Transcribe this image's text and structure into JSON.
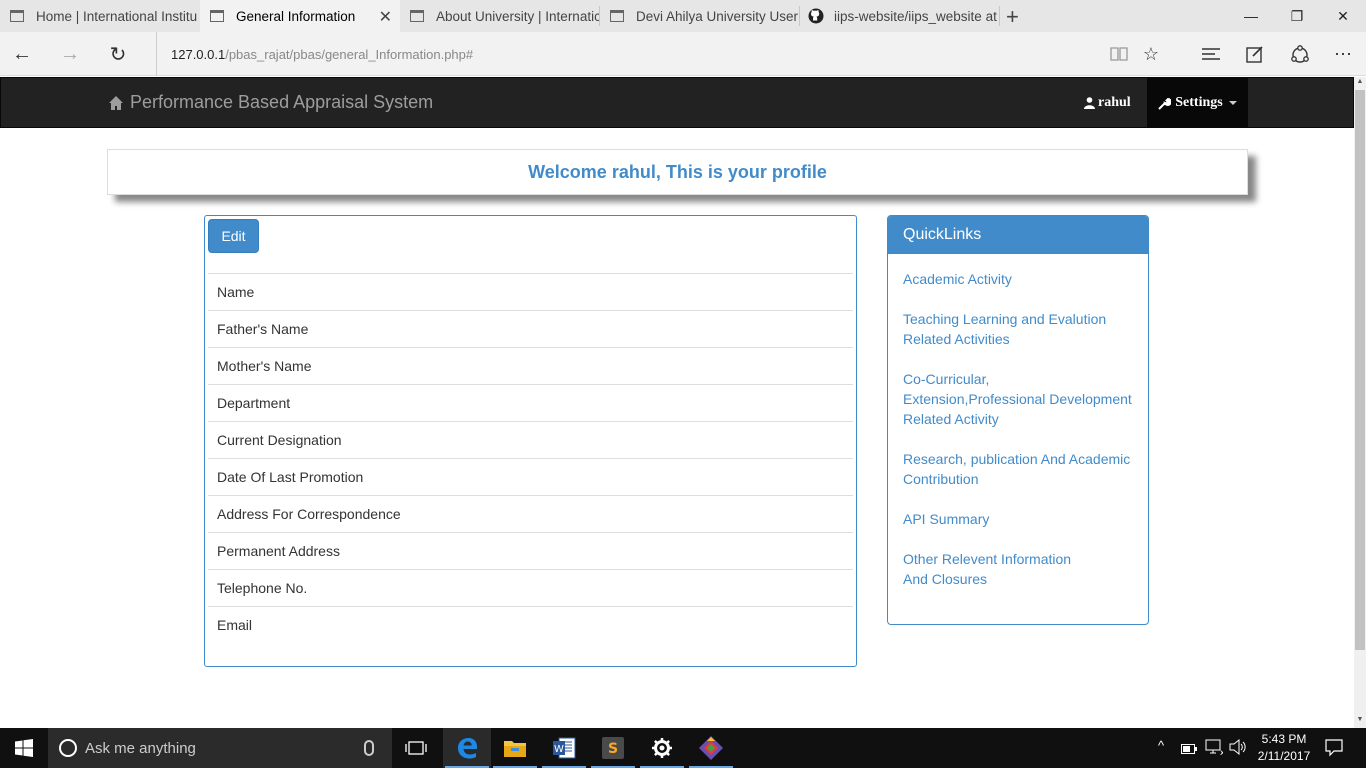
{
  "browser": {
    "tabs": [
      {
        "title": "Home | International Institu"
      },
      {
        "title": "General Information"
      },
      {
        "title": "About University | Internatic"
      },
      {
        "title": "Devi Ahilya University User"
      },
      {
        "title": "iips-website/iips_website at"
      }
    ],
    "url_host": "127.0.0.1",
    "url_path": "/pbas_rajat/pbas/general_Information.php#"
  },
  "navbar": {
    "brand": "Performance Based Appraisal System",
    "user": "rahul",
    "settings": "Settings"
  },
  "welcome": "Welcome rahul, This is your profile",
  "profile": {
    "edit_label": "Edit",
    "fields": [
      "Name",
      "Father's Name",
      "Mother's Name",
      "Department",
      "Current Designation",
      "Date Of Last Promotion",
      "Address For Correspondence",
      "Permanent Address",
      "Telephone No.",
      "Email"
    ]
  },
  "quicklinks": {
    "title": "QuickLinks",
    "links": [
      {
        "line1": "Academic Activity",
        "line2": ""
      },
      {
        "line1": "Teaching Learning and Evalution",
        "line2": "Related Activities"
      },
      {
        "line1": "Co-Curricular,",
        "line2": "Extension,Professional Development",
        "line3": "Related Activity"
      },
      {
        "line1": "Research, publication And Academic",
        "line2": "Contribution"
      },
      {
        "line1": "API Summary",
        "line2": ""
      },
      {
        "line1": "Other Relevent Information",
        "line2": "And Closures"
      }
    ]
  },
  "taskbar": {
    "search_placeholder": "Ask me anything",
    "time": "5:43 PM",
    "date": "2/11/2017"
  },
  "colors": {
    "primary": "#428bca",
    "navbar": "#222222",
    "taskbar": "#101010"
  }
}
